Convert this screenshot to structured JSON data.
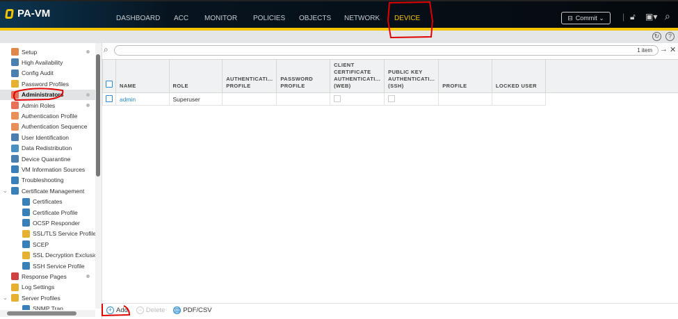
{
  "header": {
    "logo": "PA-VM",
    "nav": [
      "DASHBOARD",
      "ACC",
      "MONITOR",
      "POLICIES",
      "OBJECTS",
      "NETWORK",
      "DEVICE"
    ],
    "active": "DEVICE",
    "commit_label": "Commit ⌄"
  },
  "sidebar": {
    "items": [
      {
        "label": "Setup",
        "color": "#e0884a",
        "dot": true
      },
      {
        "label": "High Availability",
        "color": "#4a7fb0"
      },
      {
        "label": "Config Audit",
        "color": "#4a7fb0"
      },
      {
        "label": "Password Profiles",
        "color": "#e6b030"
      },
      {
        "label": "Administrators",
        "color": "#e8705a",
        "dot": true,
        "selected": true
      },
      {
        "label": "Admin Roles",
        "color": "#e8705a",
        "dot": true
      },
      {
        "label": "Authentication Profile",
        "color": "#e8905a"
      },
      {
        "label": "Authentication Sequence",
        "color": "#e8905a"
      },
      {
        "label": "User Identification",
        "color": "#4a7fb0"
      },
      {
        "label": "Data Redistribution",
        "color": "#4a90c0"
      },
      {
        "label": "Device Quarantine",
        "color": "#4a7fb0"
      },
      {
        "label": "VM Information Sources",
        "color": "#3a80b8"
      },
      {
        "label": "Troubleshooting",
        "color": "#3a80b8"
      },
      {
        "label": "Certificate Management",
        "color": "#3a80b8",
        "expanded": true
      },
      {
        "label": "Certificates",
        "color": "#3a80b8",
        "sub": true
      },
      {
        "label": "Certificate Profile",
        "color": "#3a80b8",
        "sub": true
      },
      {
        "label": "OCSP Responder",
        "color": "#3a80b8",
        "sub": true
      },
      {
        "label": "SSL/TLS Service Profile",
        "color": "#e6b030",
        "sub": true
      },
      {
        "label": "SCEP",
        "color": "#3a80b8",
        "sub": true
      },
      {
        "label": "SSL Decryption Exclusic",
        "color": "#e6b030",
        "sub": true
      },
      {
        "label": "SSH Service Profile",
        "color": "#3a80b8",
        "sub": true
      },
      {
        "label": "Response Pages",
        "color": "#d04040",
        "dot": true
      },
      {
        "label": "Log Settings",
        "color": "#e6b030"
      },
      {
        "label": "Server Profiles",
        "color": "#e6b030",
        "expanded": true
      },
      {
        "label": "SNMP Trap",
        "color": "#3a80b8",
        "sub": true
      }
    ]
  },
  "search": {
    "count": "1 item"
  },
  "table": {
    "columns": [
      "NAME",
      "ROLE",
      "AUTHENTICATI... PROFILE",
      "PASSWORD PROFILE",
      "CLIENT CERTIFICATE AUTHENTICATI... (WEB)",
      "PUBLIC KEY AUTHENTICATI... (SSH)",
      "PROFILE",
      "LOCKED USER"
    ],
    "rows": [
      {
        "name": "admin",
        "role": "Superuser",
        "auth_profile": "",
        "password_profile": "",
        "client_cert": false,
        "public_key": false,
        "profile": "",
        "locked_user": ""
      }
    ]
  },
  "toolbar": {
    "add": "Add",
    "delete": "Delete",
    "export": "PDF/CSV"
  },
  "colors": {
    "accent": "#f5c400",
    "link": "#2b8ccd",
    "annotation": "#e00000"
  }
}
